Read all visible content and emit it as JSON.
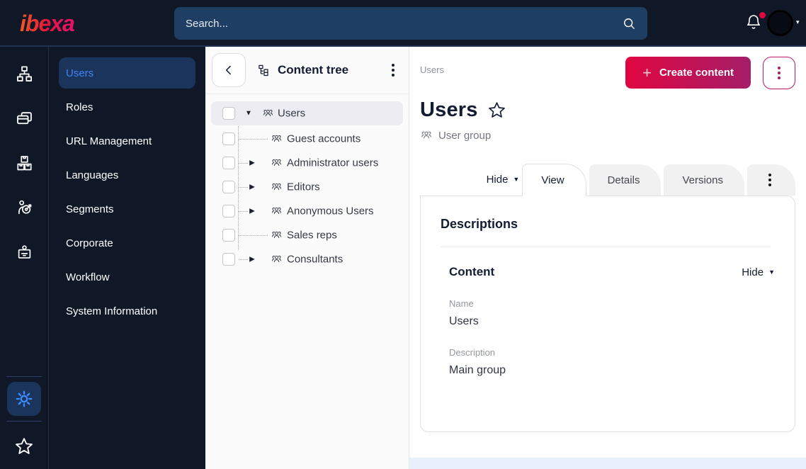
{
  "colors": {
    "topbar_bg": "#101828",
    "search_bg": "#1e3e63",
    "accent_blue": "#4285f4",
    "selected_item_bg": "#1a345c",
    "brand_gradient_start": "#e00640",
    "brand_gradient_end": "#a41e68",
    "notification_dot": "#e0063f",
    "tree_selected_bg": "#ececf2"
  },
  "topbar": {
    "logo_text": "ibexa",
    "search": {
      "placeholder": "Search..."
    },
    "icons": [
      "bell-icon",
      "avatar",
      "chevron-down-icon"
    ]
  },
  "iconbar": {
    "icons": [
      "content-structure-icon",
      "pages-icon",
      "products-icon",
      "personalization-icon",
      "admin-badge-icon"
    ],
    "bottom_icons": [
      "settings-gear-icon",
      "bookmarks-star-icon"
    ]
  },
  "sidebar": {
    "items": [
      {
        "label": "Users",
        "active": true
      },
      {
        "label": "Roles"
      },
      {
        "label": "URL Management"
      },
      {
        "label": "Languages"
      },
      {
        "label": "Segments"
      },
      {
        "label": "Corporate"
      },
      {
        "label": "Workflow"
      },
      {
        "label": "System Information"
      }
    ]
  },
  "content_tree": {
    "title": "Content tree",
    "items": [
      {
        "label": "Users",
        "state": "expanded",
        "depth": 0,
        "selected": true
      },
      {
        "label": "Guest accounts",
        "state": "leaf",
        "depth": 1
      },
      {
        "label": "Administrator users",
        "state": "collapsed",
        "depth": 1
      },
      {
        "label": "Editors",
        "state": "collapsed",
        "depth": 1
      },
      {
        "label": "Anonymous Users",
        "state": "collapsed",
        "depth": 1
      },
      {
        "label": "Sales reps",
        "state": "leaf",
        "depth": 1
      },
      {
        "label": "Consultants",
        "state": "collapsed",
        "depth": 1
      }
    ]
  },
  "main": {
    "breadcrumb": "Users",
    "create_button_label": "Create content",
    "title": "Users",
    "content_type_label": "User group",
    "tabs": [
      {
        "label": "View",
        "active": true
      },
      {
        "label": "Details"
      },
      {
        "label": "Versions"
      },
      {
        "kebab": true
      }
    ],
    "hide_toggle_label": "Hide",
    "card": {
      "heading": "Descriptions",
      "section_heading": "Content",
      "section_hide_label": "Hide",
      "fields": [
        {
          "label": "Name",
          "value": "Users"
        },
        {
          "label": "Description",
          "value": "Main group"
        }
      ]
    }
  }
}
